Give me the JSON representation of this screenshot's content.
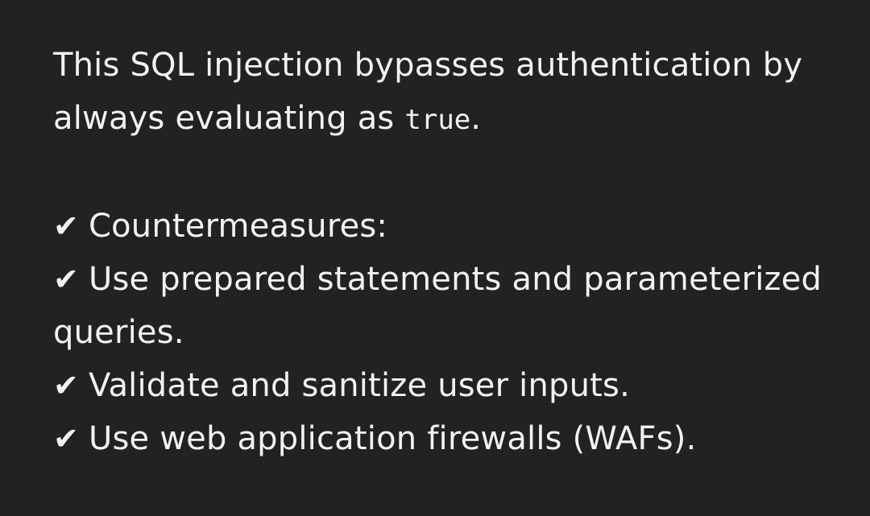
{
  "message": {
    "intro_pre": "This SQL injection bypasses authentication by always evaluating as ",
    "intro_code": "true",
    "intro_post": ".",
    "check_symbol": "✔",
    "items": [
      "Countermeasures:",
      "Use prepared statements and parameterized queries.",
      "Validate and sanitize user inputs.",
      "Use web application firewalls (WAFs)."
    ]
  }
}
